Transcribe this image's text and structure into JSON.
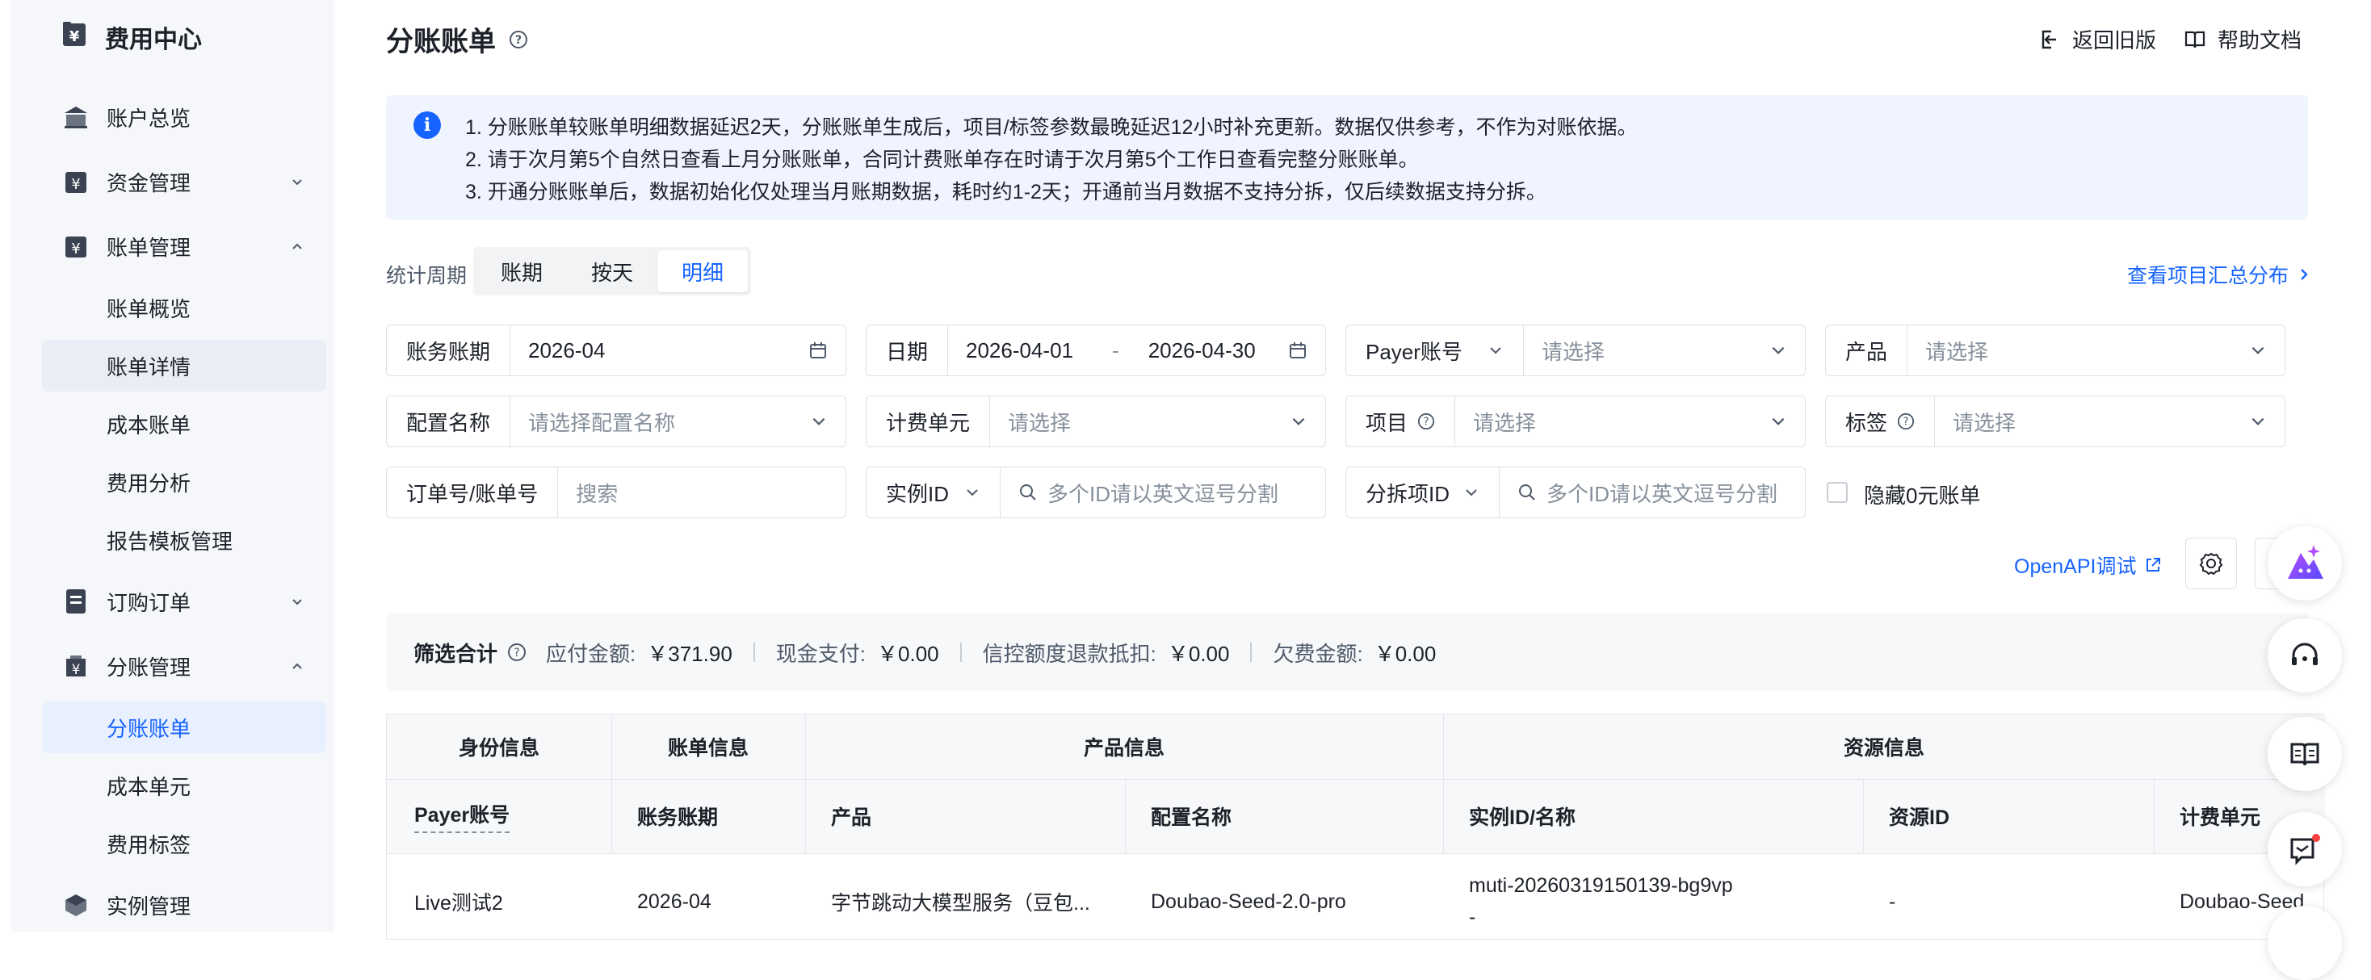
{
  "sidebar": {
    "brand": "费用中心",
    "items": [
      {
        "label": "账户总览"
      },
      {
        "label": "资金管理"
      },
      {
        "label": "账单管理"
      },
      {
        "label": "账单概览"
      },
      {
        "label": "账单详情"
      },
      {
        "label": "成本账单"
      },
      {
        "label": "费用分析"
      },
      {
        "label": "报告模板管理"
      },
      {
        "label": "订购订单"
      },
      {
        "label": "分账管理"
      },
      {
        "label": "分账账单"
      },
      {
        "label": "成本单元"
      },
      {
        "label": "费用标签"
      },
      {
        "label": "实例管理"
      }
    ]
  },
  "header": {
    "title": "分账账单",
    "back_label": "返回旧版",
    "help_label": "帮助文档"
  },
  "notice": {
    "lines": [
      "1. 分账账单较账单明细数据延迟2天，分账账单生成后，项目/标签参数最晚延迟12小时补充更新。数据仅供参考，不作为对账依据。",
      "2. 请于次月第5个自然日查看上月分账账单，合同计费账单存在时请于次月第5个工作日查看完整分账账单。",
      "3. 开通分账账单后，数据初始化仅处理当月账期数据，耗时约1-2天；开通前当月数据不支持分拆，仅后续数据支持分拆。"
    ]
  },
  "period": {
    "label": "统计周期",
    "options": [
      "账期",
      "按天",
      "明细"
    ],
    "selected": "明细"
  },
  "summary_link": "查看项目汇总分布",
  "filters": {
    "billing_period": {
      "label": "账务账期",
      "value": "2026-04"
    },
    "date": {
      "label": "日期",
      "start": "2026-04-01",
      "sep": "-",
      "end": "2026-04-30"
    },
    "payer": {
      "label": "Payer账号",
      "placeholder": "请选择"
    },
    "product": {
      "label": "产品",
      "placeholder": "请选择"
    },
    "config": {
      "label": "配置名称",
      "placeholder": "请选择配置名称"
    },
    "billing_unit": {
      "label": "计费单元",
      "placeholder": "请选择"
    },
    "project": {
      "label": "项目",
      "placeholder": "请选择"
    },
    "tag": {
      "label": "标签",
      "placeholder": "请选择"
    },
    "order": {
      "label": "订单号/账单号",
      "placeholder": "搜索"
    },
    "instance": {
      "label": "实例ID",
      "placeholder": "多个ID请以英文逗号分割"
    },
    "split": {
      "label": "分拆项ID",
      "placeholder": "多个ID请以英文逗号分割"
    },
    "hide_zero": {
      "label": "隐藏0元账单",
      "checked": false
    }
  },
  "openapi_label": "OpenAPI调试",
  "summary": {
    "title": "筛选合计",
    "items": [
      {
        "k": "应付金额:",
        "v": "￥371.90"
      },
      {
        "k": "现金支付:",
        "v": "￥0.00"
      },
      {
        "k": "信控额度退款抵扣:",
        "v": "￥0.00"
      },
      {
        "k": "欠费金额:",
        "v": "￥0.00"
      }
    ]
  },
  "table": {
    "groups": [
      "身份信息",
      "账单信息",
      "产品信息",
      "资源信息"
    ],
    "columns": [
      "Payer账号",
      "账务账期",
      "产品",
      "配置名称",
      "实例ID/名称",
      "资源ID",
      "计费单元"
    ],
    "rows": [
      {
        "payer": "Live测试2",
        "period": "2026-04",
        "product": "字节跳动大模型服务（豆包...",
        "config": "Doubao-Seed-2.0-pro",
        "instance": "muti-20260319150139-bg9vp",
        "instance_name": "-",
        "resource": "-",
        "unit": "Doubao-Seed"
      }
    ]
  },
  "colors": {
    "accent": "#1664ff",
    "notice_bg": "#f0f4ff",
    "sidebar_bg": "#f5f7fa"
  }
}
